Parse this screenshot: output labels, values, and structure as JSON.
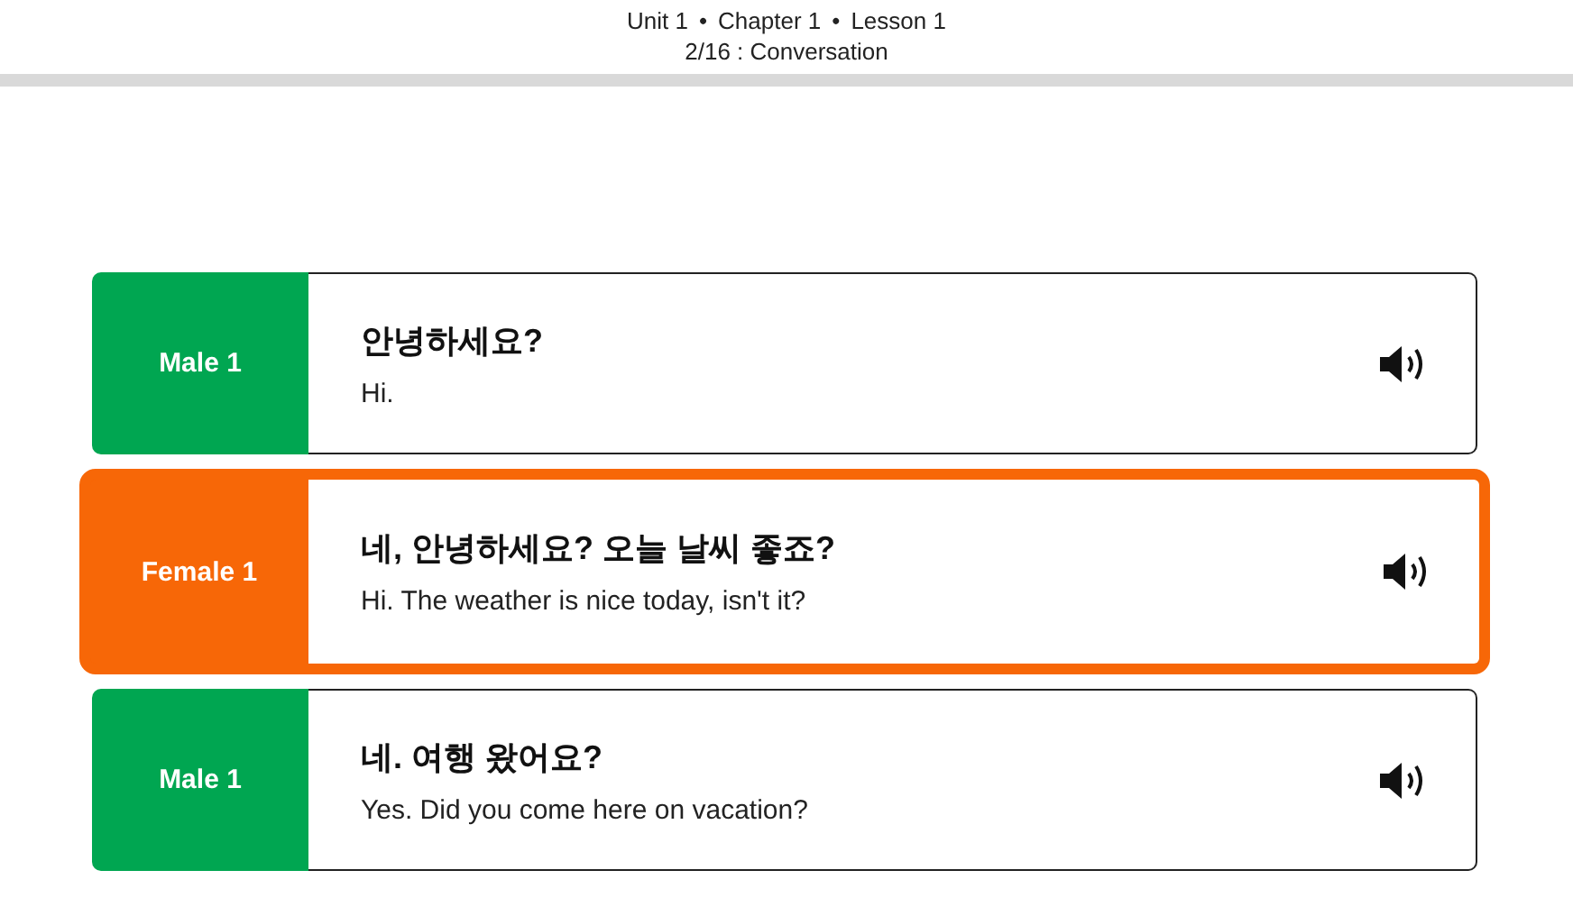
{
  "header": {
    "breadcrumb": [
      "Unit 1",
      "Chapter 1",
      "Lesson 1"
    ],
    "separator": "•",
    "subtitle": "2/16 : Conversation"
  },
  "lines": [
    {
      "speaker": "Male 1",
      "color": "#00a651",
      "selected": false,
      "korean": "안녕하세요?",
      "english": "Hi."
    },
    {
      "speaker": "Female 1",
      "color": "#f76707",
      "selected": true,
      "korean": "네, 안녕하세요? 오늘 날씨 좋죠?",
      "english": "Hi. The weather is nice today, isn't it?"
    },
    {
      "speaker": "Male 1",
      "color": "#00a651",
      "selected": false,
      "korean": "네. 여행 왔어요?",
      "english": "Yes. Did you come here on vacation?"
    }
  ]
}
